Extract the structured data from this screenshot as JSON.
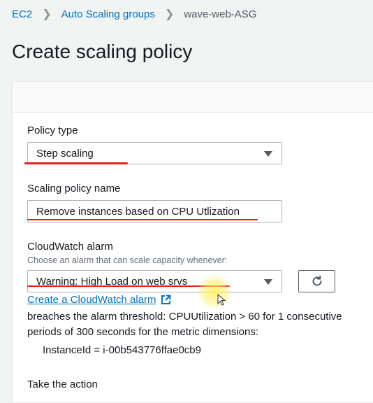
{
  "breadcrumb": {
    "items": [
      "EC2",
      "Auto Scaling groups"
    ],
    "current": "wave-web-ASG"
  },
  "page_title": "Create scaling policy",
  "form": {
    "policy_type": {
      "label": "Policy type",
      "value": "Step scaling"
    },
    "policy_name": {
      "label": "Scaling policy name",
      "value": "Remove instances based on CPU Utlization"
    },
    "cloudwatch_alarm": {
      "label": "CloudWatch alarm",
      "hint": "Choose an alarm that can scale capacity whenever:",
      "value": "Warning: High Load on web srvs",
      "create_link": "Create a CloudWatch alarm",
      "description_line1": "breaches the alarm threshold: CPUUtilization > 60 for 1 consecutive",
      "description_line2": "periods of 300 seconds for the metric dimensions:",
      "dimension": "InstanceId = i-00b543776ffae0cb9"
    },
    "take_action": {
      "label": "Take the action"
    }
  },
  "colors": {
    "accent_link": "#0073bb",
    "annotation_red": "#e41f1f",
    "highlight": "#fff05a"
  },
  "icons": {
    "breadcrumb_separator": "chevron-right-icon",
    "dropdown": "caret-down-icon",
    "refresh": "refresh-icon",
    "external_link": "external-link-icon",
    "cursor": "mouse-pointer-icon"
  }
}
